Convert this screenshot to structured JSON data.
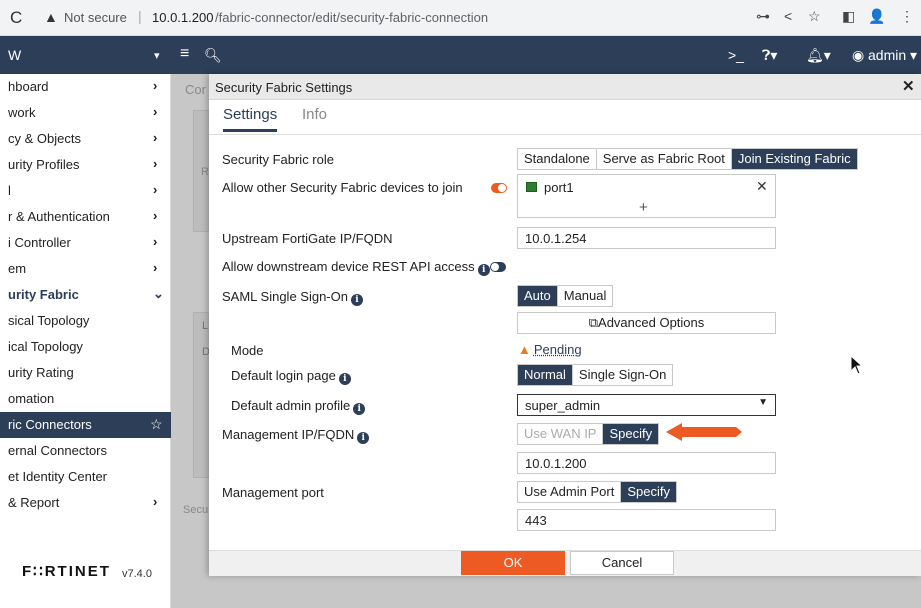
{
  "browser": {
    "security": "Not secure",
    "host": "10.0.1.200",
    "path": "/fabric-connector/edit/security-fabric-connection"
  },
  "topbar": {
    "app_title": "W",
    "user": "admin"
  },
  "sidebar": {
    "items": [
      {
        "label": "hboard"
      },
      {
        "label": "work"
      },
      {
        "label": "cy & Objects"
      },
      {
        "label": "urity Profiles"
      },
      {
        "label": "l"
      },
      {
        "label": "r & Authentication"
      },
      {
        "label": "i Controller"
      },
      {
        "label": "em"
      },
      {
        "label": "urity Fabric"
      },
      {
        "label": "sical Topology"
      },
      {
        "label": "ical Topology"
      },
      {
        "label": "urity Rating"
      },
      {
        "label": "omation"
      },
      {
        "label": "ric Connectors"
      },
      {
        "label": "ernal Connectors"
      },
      {
        "label": "et Identity Center"
      },
      {
        "label": "& Report"
      }
    ],
    "logo": "F∷RTINET",
    "version": "v7.4.0"
  },
  "backdrop": {
    "crumb": "Cor",
    "letter_r": "R",
    "letter_l": "L",
    "letter_d": "D",
    "footer_text": "Secu"
  },
  "dialog": {
    "title": "Security Fabric Settings",
    "tabs": [
      {
        "label": "Settings"
      },
      {
        "label": "Info"
      }
    ],
    "fabric_role": {
      "label": "Security Fabric role",
      "options": [
        "Standalone",
        "Serve as Fabric Root",
        "Join Existing Fabric"
      ],
      "selected": "Join Existing Fabric"
    },
    "allow_join": {
      "label": "Allow other Security Fabric devices to join",
      "interface": "port1",
      "add_symbol": "+"
    },
    "upstream": {
      "label": "Upstream FortiGate IP/FQDN",
      "value": "10.0.1.254"
    },
    "rest_api": {
      "label": "Allow downstream device REST API access"
    },
    "saml": {
      "label": "SAML Single Sign-On",
      "options": [
        "Auto",
        "Manual"
      ],
      "selected": "Auto",
      "advanced_options": "Advanced Options",
      "mode_label": "Mode",
      "mode_value": "Pending",
      "login_page_label": "Default login page",
      "login_page_options": [
        "Normal",
        "Single Sign-On"
      ],
      "login_page_selected": "Normal",
      "admin_profile_label": "Default admin profile",
      "admin_profile_value": "super_admin"
    },
    "mgmt_ip": {
      "label": "Management IP/FQDN",
      "options": [
        "Use WAN IP",
        "Specify"
      ],
      "selected": "Specify",
      "value": "10.0.1.200"
    },
    "mgmt_port": {
      "label": "Management port",
      "options": [
        "Use Admin Port",
        "Specify"
      ],
      "selected": "Specify",
      "value": "443"
    },
    "ok_label": "OK",
    "cancel_label": "Cancel"
  },
  "colors": {
    "navy": "#2c3e58",
    "accent_orange": "#ee5a24",
    "toggle_on": "#ee5a24"
  }
}
